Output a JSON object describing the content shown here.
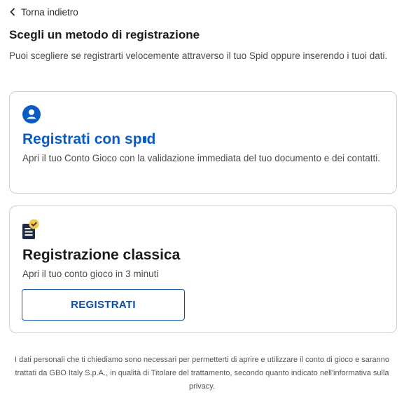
{
  "back": {
    "label": "Torna indietro",
    "icon": "chevron-left-icon"
  },
  "header": {
    "title": "Scegli un metodo di registrazione",
    "subtitle": "Puoi scegliere se registrarti velocemente attraverso il tuo Spid oppure inserendo i tuoi dati."
  },
  "spid_option": {
    "icon": "user-circle-icon",
    "title_prefix": "Registrati con",
    "logo_text_start": "sp",
    "logo_text_end": "d",
    "description": "Apri il tuo Conto Gioco con la validazione immediata del tuo documento e dei contatti."
  },
  "classic_option": {
    "icon": "document-check-icon",
    "title": "Registrazione classica",
    "description": "Apri il tuo conto gioco in 3 minuti",
    "button_label": "REGISTRATI"
  },
  "footer": {
    "text": "I dati personali che ti chiediamo sono necessari per permetterti di aprire e utilizzare il conto di gioco e saranno trattati da GBO Italy S.p.A., in qualità di Titolare del trattamento, secondo quanto indicato nell'informativa sulla privacy."
  },
  "colors": {
    "accent": "#0b5bc4",
    "button_border": "#0b4fa3",
    "check_badge": "#f2c94c",
    "doc_icon": "#1f2a44"
  }
}
